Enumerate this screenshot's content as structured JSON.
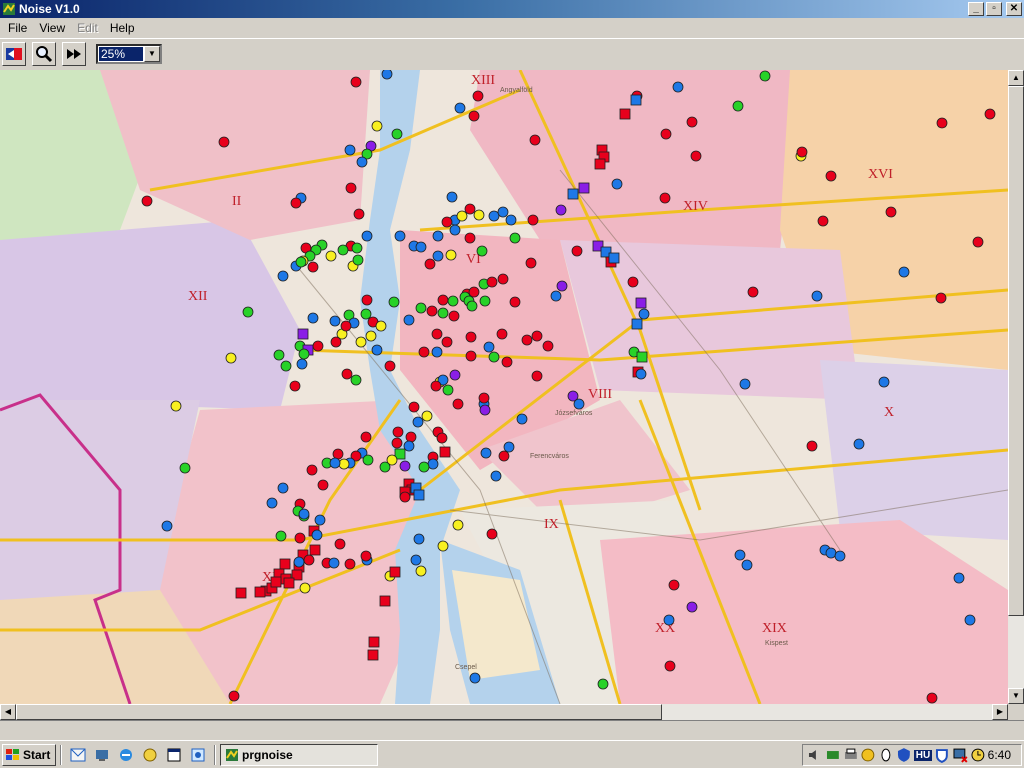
{
  "window": {
    "title": "Noise V1.0"
  },
  "window_buttons": [
    "minimize",
    "restore",
    "close"
  ],
  "menu": [
    {
      "label": "File",
      "enabled": true
    },
    {
      "label": "View",
      "enabled": true
    },
    {
      "label": "Edit",
      "enabled": false
    },
    {
      "label": "Help",
      "enabled": true
    }
  ],
  "toolbar": {
    "buttons": [
      "flag-icon",
      "magnifier-icon",
      "fast-forward-icon"
    ],
    "zoom": "25%"
  },
  "map": {
    "district_labels": [
      "XIII",
      "XVI",
      "II",
      "XIV",
      "VI",
      "XII",
      "VIII",
      "X",
      "IX",
      "XI",
      "XX",
      "XIX"
    ],
    "colors": {
      "red": "#e8001c",
      "blue": "#1e78e6",
      "green": "#28d228",
      "yellow": "#f8f020",
      "purple": "#8a1ee6"
    },
    "place_labels": [
      "Csepel",
      "Angyalföld",
      "Józsefváros",
      "Ferencváros",
      "Kispest"
    ]
  },
  "taskbar": {
    "start_label": "Start",
    "task_label": "prgnoise",
    "tray_lang": "HU",
    "clock": "6:40"
  }
}
